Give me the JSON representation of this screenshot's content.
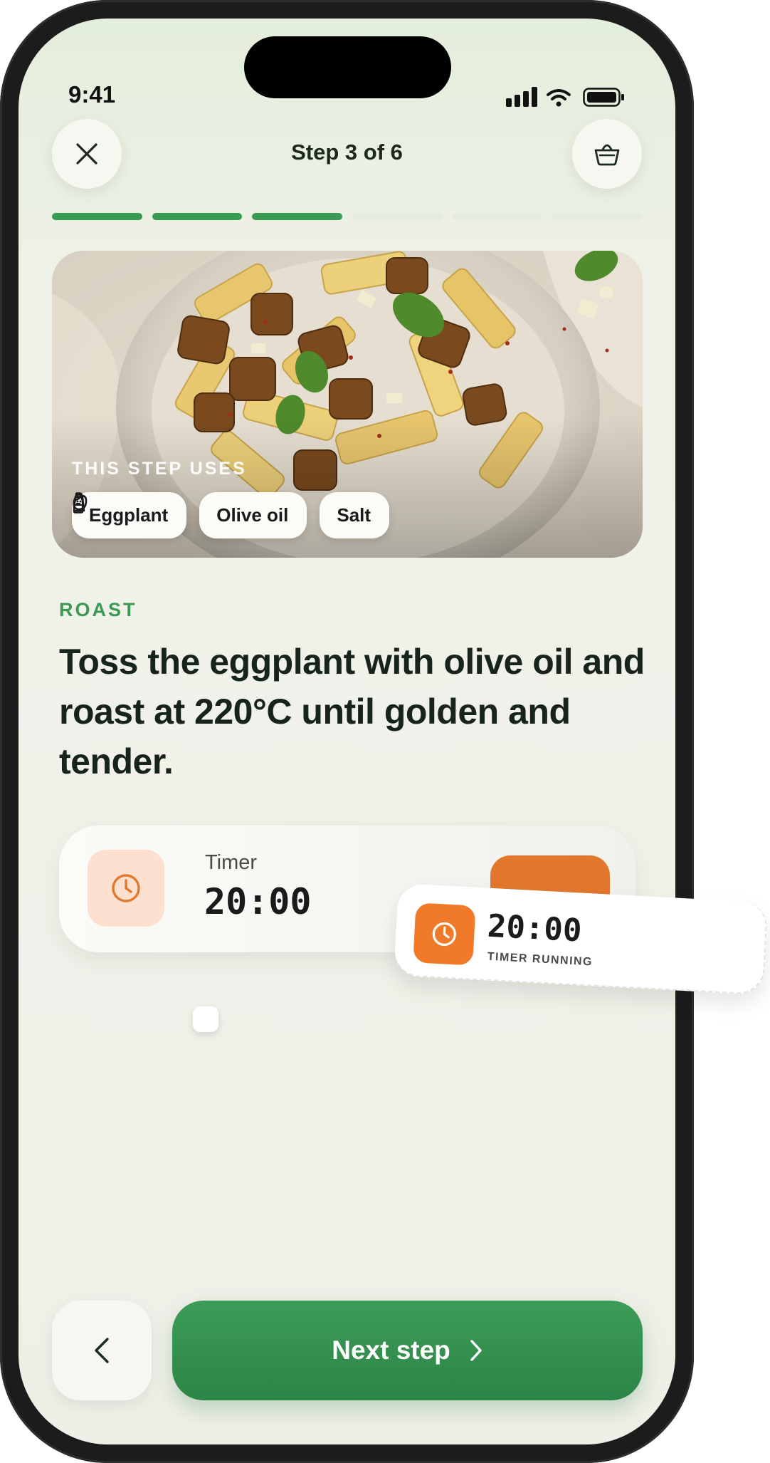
{
  "status_bar": {
    "time": "9:41",
    "icons": [
      "signal-icon",
      "wifi-icon",
      "battery-icon"
    ]
  },
  "header": {
    "title": "Step 3 of 6",
    "close_icon": "close-icon",
    "basket_icon": "basket-icon"
  },
  "progress": {
    "current_step": 3,
    "total_steps": 6
  },
  "hero": {
    "uses_label": "THIS STEP USES",
    "ingredients": [
      {
        "label": "Eggplant",
        "icon": "eggplant-icon"
      },
      {
        "label": "Olive oil",
        "icon": "bottle-icon"
      },
      {
        "label": "Salt",
        "icon": "salt-shaker-icon"
      }
    ]
  },
  "step": {
    "category": "ROAST",
    "instruction": "Toss the eggplant with olive oil and roast at 220°C until golden and tender."
  },
  "timer": {
    "label": "Timer",
    "value": "20:00",
    "icon": "clock-icon"
  },
  "floating_timer": {
    "value": "20:00",
    "status": "TIMER RUNNING",
    "icon": "clock-icon"
  },
  "footer": {
    "back_icon": "chevron-left-icon",
    "next_label": "Next step",
    "next_icon": "chevron-right-icon"
  },
  "colors": {
    "accent_green": "#3a9a54",
    "accent_orange": "#f07a2a",
    "text_dark": "#16241a"
  }
}
